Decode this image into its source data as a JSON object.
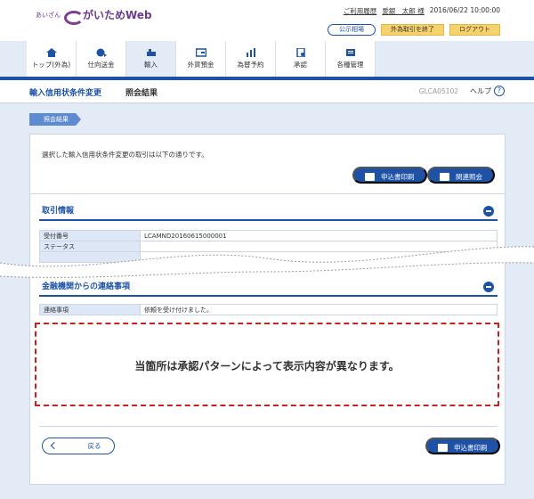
{
  "header": {
    "logo_small": "あいざん",
    "logo_text": "がいためWeb",
    "history_link": "ご利用履歴",
    "user": "愛銀　太郎 様",
    "datetime": "2016/06/22 10:00:00",
    "rates_button": "公示相場",
    "end_fx_button": "外為取引を終了",
    "logout_button": "ログアウト"
  },
  "nav": [
    {
      "label": "トップ(外為)",
      "icon": "home-icon"
    },
    {
      "label": "仕向送金",
      "icon": "remittance-icon"
    },
    {
      "label": "輸入",
      "icon": "import-icon"
    },
    {
      "label": "外貨預金",
      "icon": "deposit-icon"
    },
    {
      "label": "為替予約",
      "icon": "forward-icon"
    },
    {
      "label": "承認",
      "icon": "approval-icon"
    },
    {
      "label": "各種管理",
      "icon": "management-icon"
    }
  ],
  "title": {
    "main": "輸入信用状条件変更",
    "sub": "照会結果",
    "code": "GLCA05102",
    "help": "ヘルプ"
  },
  "step_label": "照会結果",
  "intro_text": "選択した輸入信用状条件変更の取引は以下の通りです。",
  "buttons": {
    "print": "申込書印刷",
    "related": "関連照会",
    "back": "戻る",
    "print_bottom": "申込書印刷"
  },
  "transaction": {
    "title": "取引情報",
    "rows": [
      {
        "label": "受付番号",
        "value": "LCAMND20160615000001"
      },
      {
        "label": "ステータス",
        "value": ""
      },
      {
        "label": "",
        "value": ""
      }
    ]
  },
  "contact": {
    "title": "金融機関からの連絡事項",
    "rows": [
      {
        "label": "連絡事項",
        "value": "依頼を受け付けました。"
      }
    ]
  },
  "note": "当箇所は承認パターンによって表示内容が異なります。",
  "colors": {
    "primary": "#1d52a7",
    "accent_red": "#cc1f1f",
    "logo": "#6b3a8e"
  }
}
